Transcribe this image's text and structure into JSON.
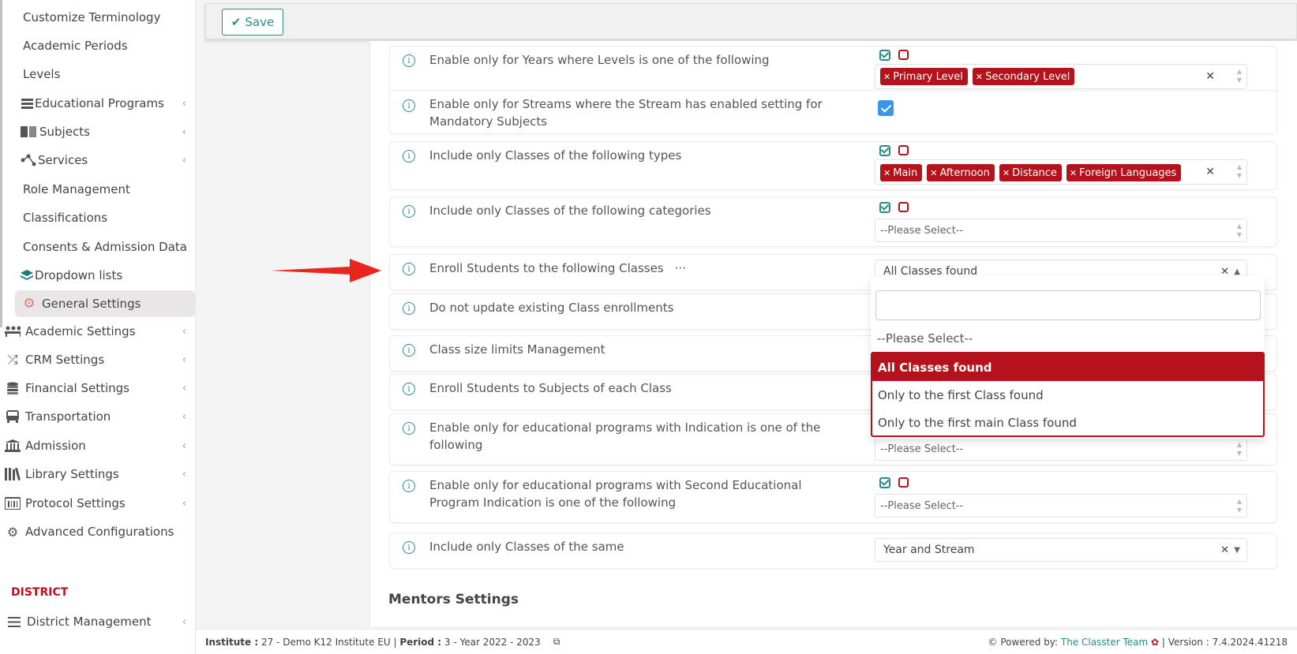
{
  "toolbar": {
    "save_label": "Save"
  },
  "sidebar": {
    "items": [
      {
        "label": "Customize Terminology",
        "icon": ""
      },
      {
        "label": "Academic Periods",
        "icon": ""
      },
      {
        "label": "Levels",
        "icon": ""
      },
      {
        "label": "Educational Programs",
        "icon": "server-icon"
      },
      {
        "label": "Subjects",
        "icon": "book-icon"
      },
      {
        "label": "Services",
        "icon": "share-nodes-icon"
      },
      {
        "label": "Role Management",
        "icon": ""
      },
      {
        "label": "Classifications",
        "icon": ""
      },
      {
        "label": "Consents & Admission Data",
        "icon": ""
      },
      {
        "label": "Dropdown lists",
        "icon": "layers-icon"
      },
      {
        "label": "General Settings",
        "icon": "gear-icon"
      },
      {
        "label": "Academic Settings",
        "icon": "users-icon"
      },
      {
        "label": "CRM Settings",
        "icon": "shuffle-icon"
      },
      {
        "label": "Financial Settings",
        "icon": "coins-icon"
      },
      {
        "label": "Transportation",
        "icon": "bus-icon"
      },
      {
        "label": "Admission",
        "icon": "institution-icon"
      },
      {
        "label": "Library Settings",
        "icon": "books-icon"
      },
      {
        "label": "Protocol Settings",
        "icon": "calendar-barcode-icon"
      },
      {
        "label": "Advanced Configurations",
        "icon": "gears-icon"
      }
    ],
    "section_district": "DISTRICT",
    "district_item": "District Management"
  },
  "rows": {
    "r1": {
      "label": "Enable only for Years where Levels is one of the following",
      "tags": [
        "Primary Level",
        "Secondary Level"
      ]
    },
    "r2": {
      "label": "Enable only for Streams where the Stream has enabled setting for Mandatory Subjects"
    },
    "r3": {
      "label": "Include only Classes of the following types",
      "tags": [
        "Main",
        "Afternoon",
        "Distance",
        "Foreign Languages"
      ]
    },
    "r4": {
      "label": "Include only Classes of the following categories",
      "placeholder": "--Please Select--"
    },
    "r5": {
      "label": "Enroll Students to the following Classes",
      "more": "···",
      "value": "All Classes found"
    },
    "r6": {
      "label": "Do not update existing Class enrollments"
    },
    "r7": {
      "label": "Class size limits Management"
    },
    "r8": {
      "label": "Enroll Students to Subjects of each Class"
    },
    "r9": {
      "label": "Enable only for educational programs with Indication is one of the following",
      "placeholder": "--Please Select--"
    },
    "r10": {
      "label": "Enable only for educational programs with Second Educational Program Indication is one of the following",
      "placeholder": "--Please Select--"
    },
    "r11": {
      "label": "Include only Classes of the same",
      "value": "Year and Stream"
    }
  },
  "dropdown": {
    "placeholder_option": "--Please Select--",
    "options": [
      "All Classes found",
      "Only to the first Class found",
      "Only to the first main Class found"
    ],
    "selected": "All Classes found"
  },
  "section_mentors": "Mentors Settings",
  "footer": {
    "institute_label": "Institute :",
    "institute_value": "27 - Demo K12 Institute EU",
    "period_label": "Period :",
    "period_value": "3 - Year 2022 - 2023",
    "powered_by": "Powered by:",
    "team": "The Classter Team",
    "version": "| Version : 7.4.2024.41218"
  }
}
